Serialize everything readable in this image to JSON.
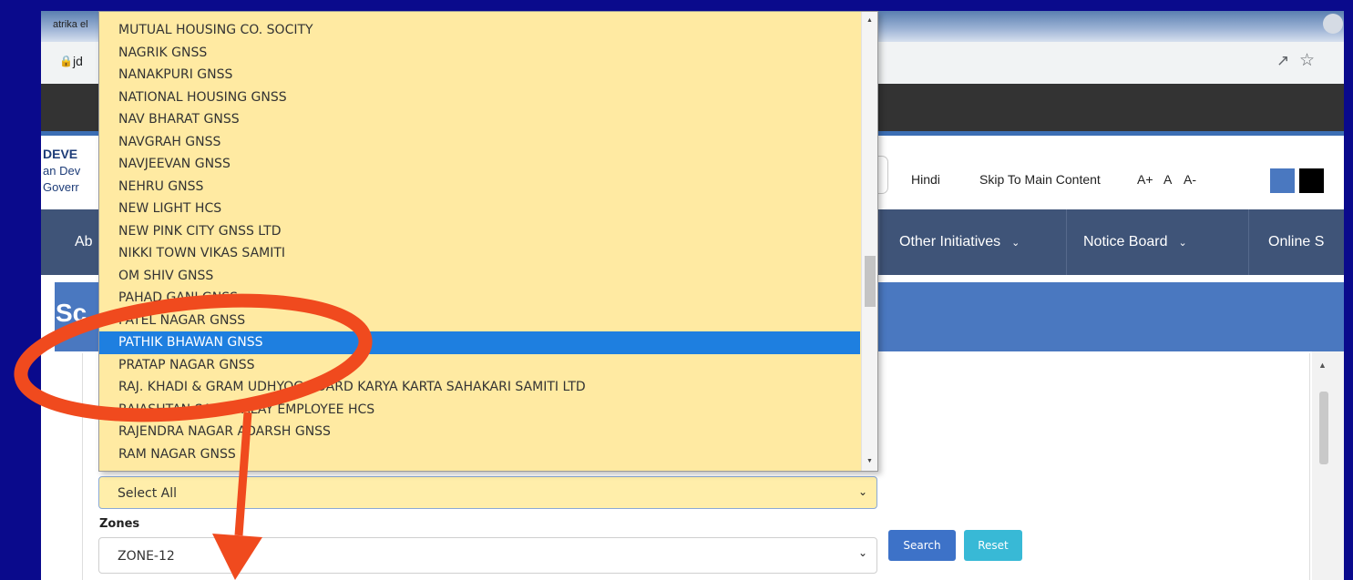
{
  "browser": {
    "tab_text": "atrika el",
    "url": "jd",
    "lock_icon": "lock-icon",
    "share_icon": "share-icon",
    "star_icon": "star-icon"
  },
  "header": {
    "brand_line_1": "DEVE",
    "brand_line_2": "an Dev",
    "brand_line_3": "Goverr",
    "util_links": {
      "hindi": "Hindi",
      "skip": "Skip To Main Content",
      "a_plus": "A+",
      "a": "A",
      "a_minus": "A-"
    },
    "theme_colors": [
      "#4a78c0",
      "#000000"
    ]
  },
  "nav": {
    "about": "Ab",
    "other": "Other Initiatives",
    "notice": "Notice Board",
    "online": "Online S",
    "chevron_icon": "chevron-down-icon"
  },
  "page": {
    "title": "Sc"
  },
  "form": {
    "society_select_value": "Select All",
    "zones_label": "Zones",
    "zone_value": "ZONE-12",
    "search_label": "Search",
    "reset_label": "Reset"
  },
  "dropdown": {
    "selected_index": 14,
    "options": [
      "MUTUAL HOUSING CO. SOCITY",
      "NAGRIK GNSS",
      "NANAKPURI GNSS",
      "NATIONAL HOUSING GNSS",
      "NAV BHARAT GNSS",
      "NAVGRAH GNSS",
      "NAVJEEVAN GNSS",
      "NEHRU GNSS",
      "NEW LIGHT HCS",
      "NEW PINK CITY GNSS LTD",
      "NIKKI TOWN VIKAS SAMITI",
      "OM SHIV GNSS",
      "PAHAD GANJ GNSS",
      "PATEL NAGAR GNSS",
      "PATHIK BHAWAN GNSS",
      "PRATAP NAGAR GNSS",
      "RAJ. KHADI & GRAM UDHYOG BOARD KARYA KARTA SAHAKARI SAMITI LTD",
      "RAJASHTAN SACHIVALAY EMPLOYEE HCS",
      "RAJENDRA NAGAR ADARSH GNSS",
      "RAM NAGAR GNSS"
    ]
  },
  "annotation": {
    "border_color": "#0a0a8c",
    "highlight_color": "#f04a1e"
  }
}
